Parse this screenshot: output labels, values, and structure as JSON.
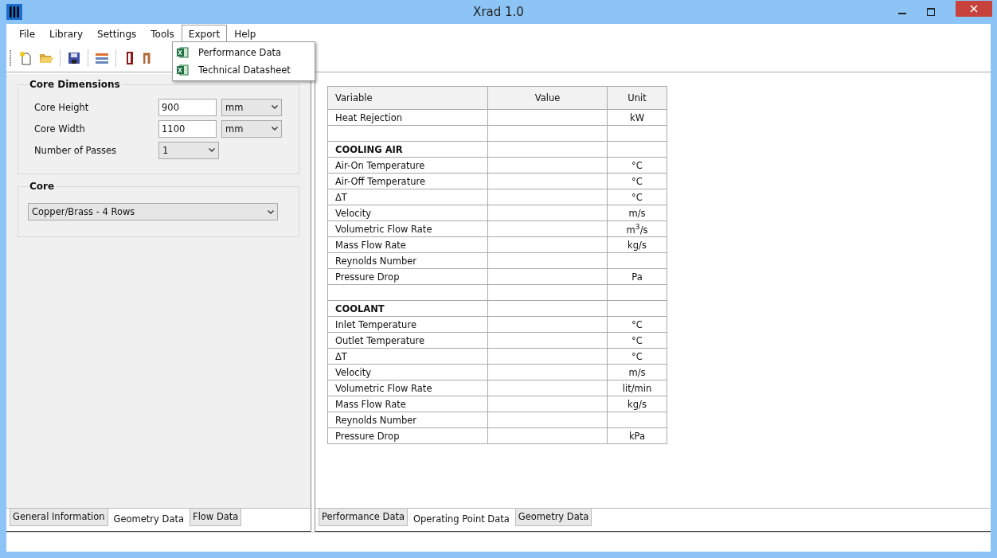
{
  "window": {
    "title": "Xrad 1.0"
  },
  "menu": [
    {
      "label": "File",
      "selected": false
    },
    {
      "label": "Library",
      "selected": false
    },
    {
      "label": "Settings",
      "selected": false
    },
    {
      "label": "Tools",
      "selected": false
    },
    {
      "label": "Export",
      "selected": true
    },
    {
      "label": "Help",
      "selected": false
    }
  ],
  "export_menu": [
    "Performance Data",
    "Technical Datasheet"
  ],
  "core_dimensions": {
    "title": "Core Dimensions",
    "fields": [
      {
        "label": "Core Height",
        "value": "900",
        "unit": "mm"
      },
      {
        "label": "Core Width",
        "value": "1100",
        "unit": "mm"
      },
      {
        "label": "Number of Passes",
        "choice": "1"
      }
    ]
  },
  "core": {
    "title": "Core",
    "choice": "Copper/Brass - 4 Rows"
  },
  "left_tabs": [
    {
      "label": "General Information",
      "selected": false
    },
    {
      "label": "Geometry Data",
      "selected": true
    },
    {
      "label": "Flow Data",
      "selected": false
    }
  ],
  "table": {
    "columns": [
      "Variable",
      "Value",
      "Unit"
    ],
    "rows": [
      {
        "kind": "row",
        "variable": "Heat Rejection",
        "unit": "kW"
      },
      {
        "kind": "blank"
      },
      {
        "kind": "section",
        "variable": "COOLING AIR"
      },
      {
        "kind": "row",
        "variable": "Air-On Temperature",
        "unit": "°C"
      },
      {
        "kind": "row",
        "variable": "Air-Off Temperature",
        "unit": "°C"
      },
      {
        "kind": "row",
        "variable": "ΔT",
        "unit": "°C"
      },
      {
        "kind": "row",
        "variable": "Velocity",
        "unit": "m/s"
      },
      {
        "kind": "row",
        "variable": "Volumetric Flow Rate",
        "unit": "m$^{3}$/s"
      },
      {
        "kind": "row",
        "variable": "Mass Flow Rate",
        "unit": "kg/s"
      },
      {
        "kind": "row",
        "variable": "Reynolds Number"
      },
      {
        "kind": "row",
        "variable": "Pressure Drop",
        "unit": "Pa"
      },
      {
        "kind": "blank"
      },
      {
        "kind": "section",
        "variable": "COOLANT"
      },
      {
        "kind": "row",
        "variable": "Inlet Temperature",
        "unit": "°C"
      },
      {
        "kind": "row",
        "variable": "Outlet Temperature",
        "unit": "°C"
      },
      {
        "kind": "row",
        "variable": "ΔT",
        "unit": "°C"
      },
      {
        "kind": "row",
        "variable": "Velocity",
        "unit": "m/s"
      },
      {
        "kind": "row",
        "variable": "Volumetric Flow Rate",
        "unit": "lit/min"
      },
      {
        "kind": "row",
        "variable": "Mass Flow Rate",
        "unit": "kg/s"
      },
      {
        "kind": "row",
        "variable": "Reynolds Number"
      },
      {
        "kind": "row",
        "variable": "Pressure Drop",
        "unit": "kPa"
      }
    ]
  },
  "right_tabs": [
    {
      "label": "Performance Data",
      "selected": false
    },
    {
      "label": "Operating Point Data",
      "selected": true
    },
    {
      "label": "Geometry Data",
      "selected": false
    }
  ]
}
